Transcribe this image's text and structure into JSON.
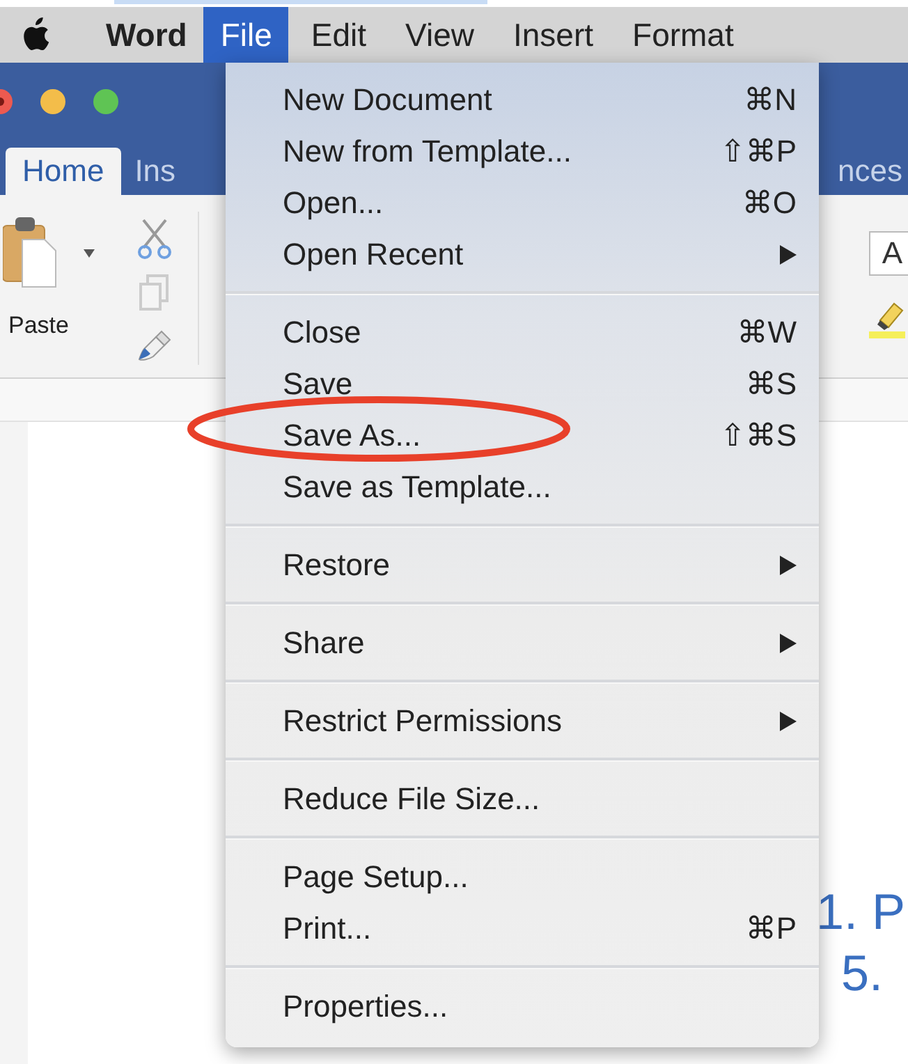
{
  "menu_bar": {
    "app_name": "Word",
    "items": [
      {
        "label": "File",
        "selected": true
      },
      {
        "label": "Edit",
        "selected": false
      },
      {
        "label": "View",
        "selected": false
      },
      {
        "label": "Insert",
        "selected": false
      },
      {
        "label": "Format",
        "selected": false
      }
    ]
  },
  "ribbon": {
    "tabs": [
      {
        "label": "Home",
        "selected": true
      },
      {
        "label": "Ins",
        "selected": false
      }
    ],
    "right_tab_fragment": "nces",
    "paste_label": "Paste",
    "font_fragment": "A"
  },
  "document": {
    "lines": [
      "1. P",
      "5."
    ]
  },
  "file_menu": {
    "groups": [
      [
        {
          "label": "New Document",
          "shortcut": "⌘N",
          "has_submenu": false
        },
        {
          "label": "New from Template...",
          "shortcut": "⇧⌘P",
          "has_submenu": false
        },
        {
          "label": "Open...",
          "shortcut": "⌘O",
          "has_submenu": false
        },
        {
          "label": "Open Recent",
          "has_submenu": true
        }
      ],
      [
        {
          "label": "Close",
          "shortcut": "⌘W",
          "has_submenu": false
        },
        {
          "label": "Save",
          "shortcut": "⌘S",
          "has_submenu": false
        },
        {
          "label": "Save As...",
          "shortcut": "⇧⌘S",
          "has_submenu": false
        },
        {
          "label": "Save as Template...",
          "has_submenu": false
        }
      ],
      [
        {
          "label": "Restore",
          "has_submenu": true
        }
      ],
      [
        {
          "label": "Share",
          "has_submenu": true
        }
      ],
      [
        {
          "label": "Restrict Permissions",
          "has_submenu": true
        }
      ],
      [
        {
          "label": "Reduce File Size...",
          "has_submenu": false
        }
      ],
      [
        {
          "label": "Page Setup...",
          "has_submenu": false
        },
        {
          "label": "Print...",
          "shortcut": "⌘P",
          "has_submenu": false
        }
      ],
      [
        {
          "label": "Properties...",
          "has_submenu": false
        }
      ]
    ]
  }
}
